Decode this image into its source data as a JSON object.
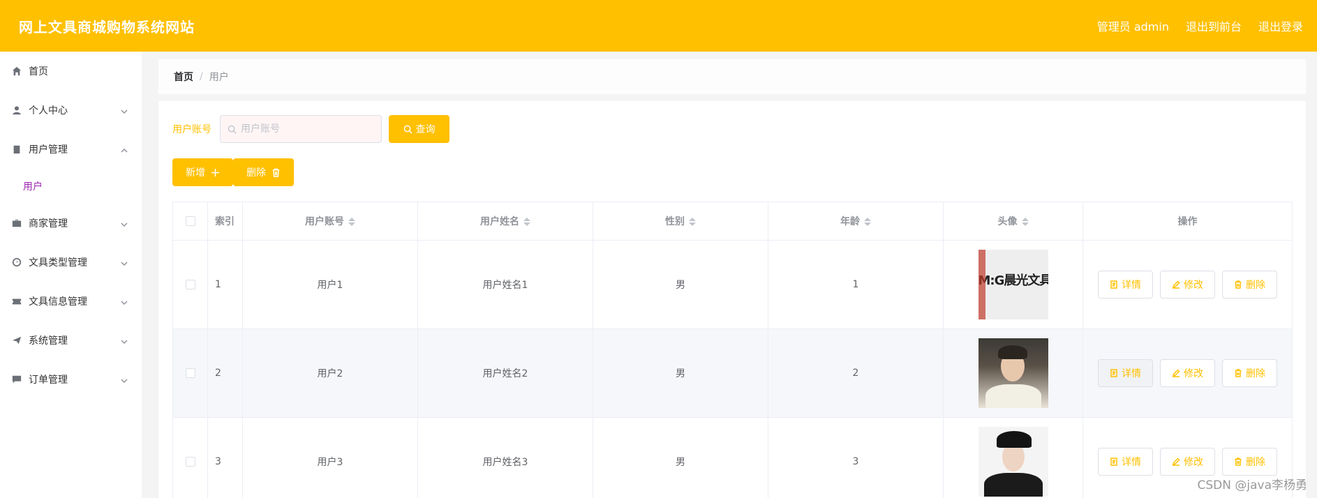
{
  "header": {
    "title": "网上文具商城购物系统网站",
    "admin": "管理员 admin",
    "front": "退出到前台",
    "logout": "退出登录"
  },
  "sidebar": {
    "items": [
      {
        "label": "首页",
        "icon": "home-icon"
      },
      {
        "label": "个人中心",
        "icon": "user-icon"
      },
      {
        "label": "用户管理",
        "icon": "clipboard-icon"
      },
      {
        "label": "商家管理",
        "icon": "briefcase-icon"
      },
      {
        "label": "文具类型管理",
        "icon": "gauge-icon"
      },
      {
        "label": "文具信息管理",
        "icon": "ticket-icon"
      },
      {
        "label": "系统管理",
        "icon": "send-icon"
      },
      {
        "label": "订单管理",
        "icon": "chat-icon"
      }
    ],
    "sub_item": "用户"
  },
  "breadcrumb": {
    "home": "首页",
    "sep": "/",
    "current": "用户"
  },
  "search": {
    "label": "用户账号",
    "placeholder": "用户账号",
    "button": "查询"
  },
  "actions": {
    "add": "新增",
    "delete": "删除"
  },
  "table": {
    "headers": {
      "index": "索引",
      "account": "用户账号",
      "name": "用户姓名",
      "gender": "性别",
      "age": "年龄",
      "avatar": "头像",
      "ops": "操作"
    },
    "rows": [
      {
        "index": "1",
        "account": "用户1",
        "name": "用户姓名1",
        "gender": "男",
        "age": "1",
        "avatar_text": "M:G晨光文具"
      },
      {
        "index": "2",
        "account": "用户2",
        "name": "用户姓名2",
        "gender": "男",
        "age": "2",
        "avatar_text": ""
      },
      {
        "index": "3",
        "account": "用户3",
        "name": "用户姓名3",
        "gender": "男",
        "age": "3",
        "avatar_text": ""
      }
    ],
    "op_detail": "详情",
    "op_edit": "修改",
    "op_delete": "删除"
  },
  "watermark": "CSDN @java李杨勇",
  "colors": {
    "accent": "#ffc000",
    "submenu": "#9c27b0"
  }
}
